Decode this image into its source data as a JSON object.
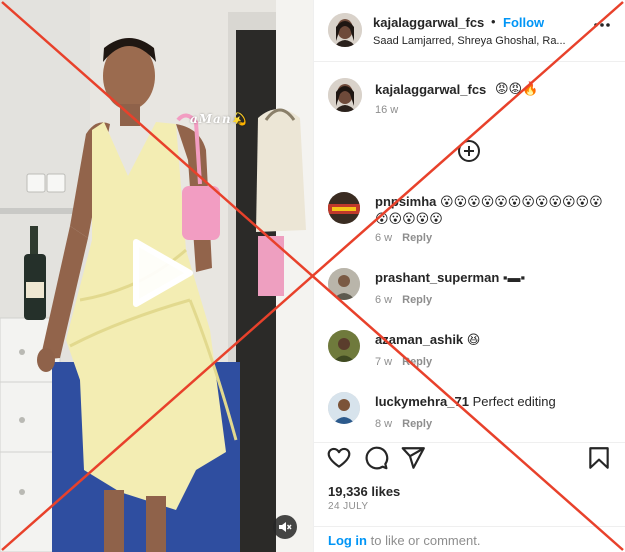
{
  "media": {
    "overlay_text": "aMan💫",
    "play_icon": "play-icon",
    "mute_icon": "speaker-muted-icon"
  },
  "post_header": {
    "username": "kajalaggarwal_fcs",
    "separator": "•",
    "follow_label": "Follow",
    "audio_label": "Saad Lamjarred, Shreya Ghoshal, Ra...",
    "more_icon": "more-options-icon"
  },
  "caption": {
    "username": "kajalaggarwal_fcs",
    "text": "😡😡🔥",
    "age": "16 w"
  },
  "load_more_icon": "plus-circle-icon",
  "comments": [
    {
      "username": "pnpsimha",
      "text": "😮😮😮😮😮😮😮😮😮😮😮😮😮😮😮😮😮",
      "age": "6 w",
      "reply_label": "Reply"
    },
    {
      "username": "prashant_superman",
      "text": "▪︎▬▪︎",
      "age": "6 w",
      "reply_label": "Reply"
    },
    {
      "username": "azaman_ashik",
      "text": "😆",
      "age": "7 w",
      "reply_label": "Reply"
    },
    {
      "username": "luckymehra_71",
      "text": "Perfect editing",
      "age": "8 w",
      "reply_label": "Reply"
    }
  ],
  "actions": {
    "like_icon": "heart-icon",
    "comment_icon": "comment-bubble-icon",
    "share_icon": "paper-plane-icon",
    "save_icon": "bookmark-icon"
  },
  "likes_count": "19,336 likes",
  "post_date": "24 JULY",
  "login_prompt": {
    "link_label": "Log in",
    "rest": " to like or comment."
  },
  "colors": {
    "accent_blue": "#0095f6",
    "cross_red": "#e8412b",
    "muted_text": "#8e8e8e",
    "dress": "#f3edb3"
  }
}
